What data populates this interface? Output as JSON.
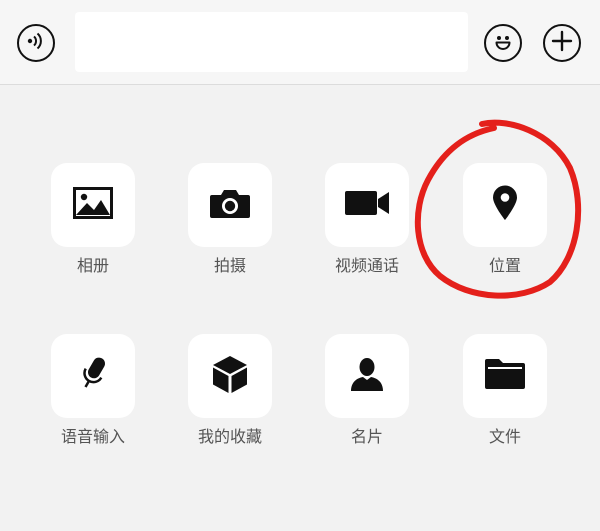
{
  "input_bar": {
    "voice_icon": "voice-icon",
    "emoji_icon": "emoji-icon",
    "plus_icon": "plus-icon",
    "text_value": ""
  },
  "panel": {
    "items": [
      {
        "label": "相册",
        "icon": "photo-album-icon"
      },
      {
        "label": "拍摄",
        "icon": "camera-icon"
      },
      {
        "label": "视频通话",
        "icon": "video-call-icon"
      },
      {
        "label": "位置",
        "icon": "location-pin-icon"
      },
      {
        "label": "语音输入",
        "icon": "microphone-icon"
      },
      {
        "label": "我的收藏",
        "icon": "favorites-cube-icon"
      },
      {
        "label": "名片",
        "icon": "contact-card-icon"
      },
      {
        "label": "文件",
        "icon": "folder-icon"
      }
    ]
  },
  "annotation": {
    "color": "#e4201b",
    "target": "位置"
  }
}
